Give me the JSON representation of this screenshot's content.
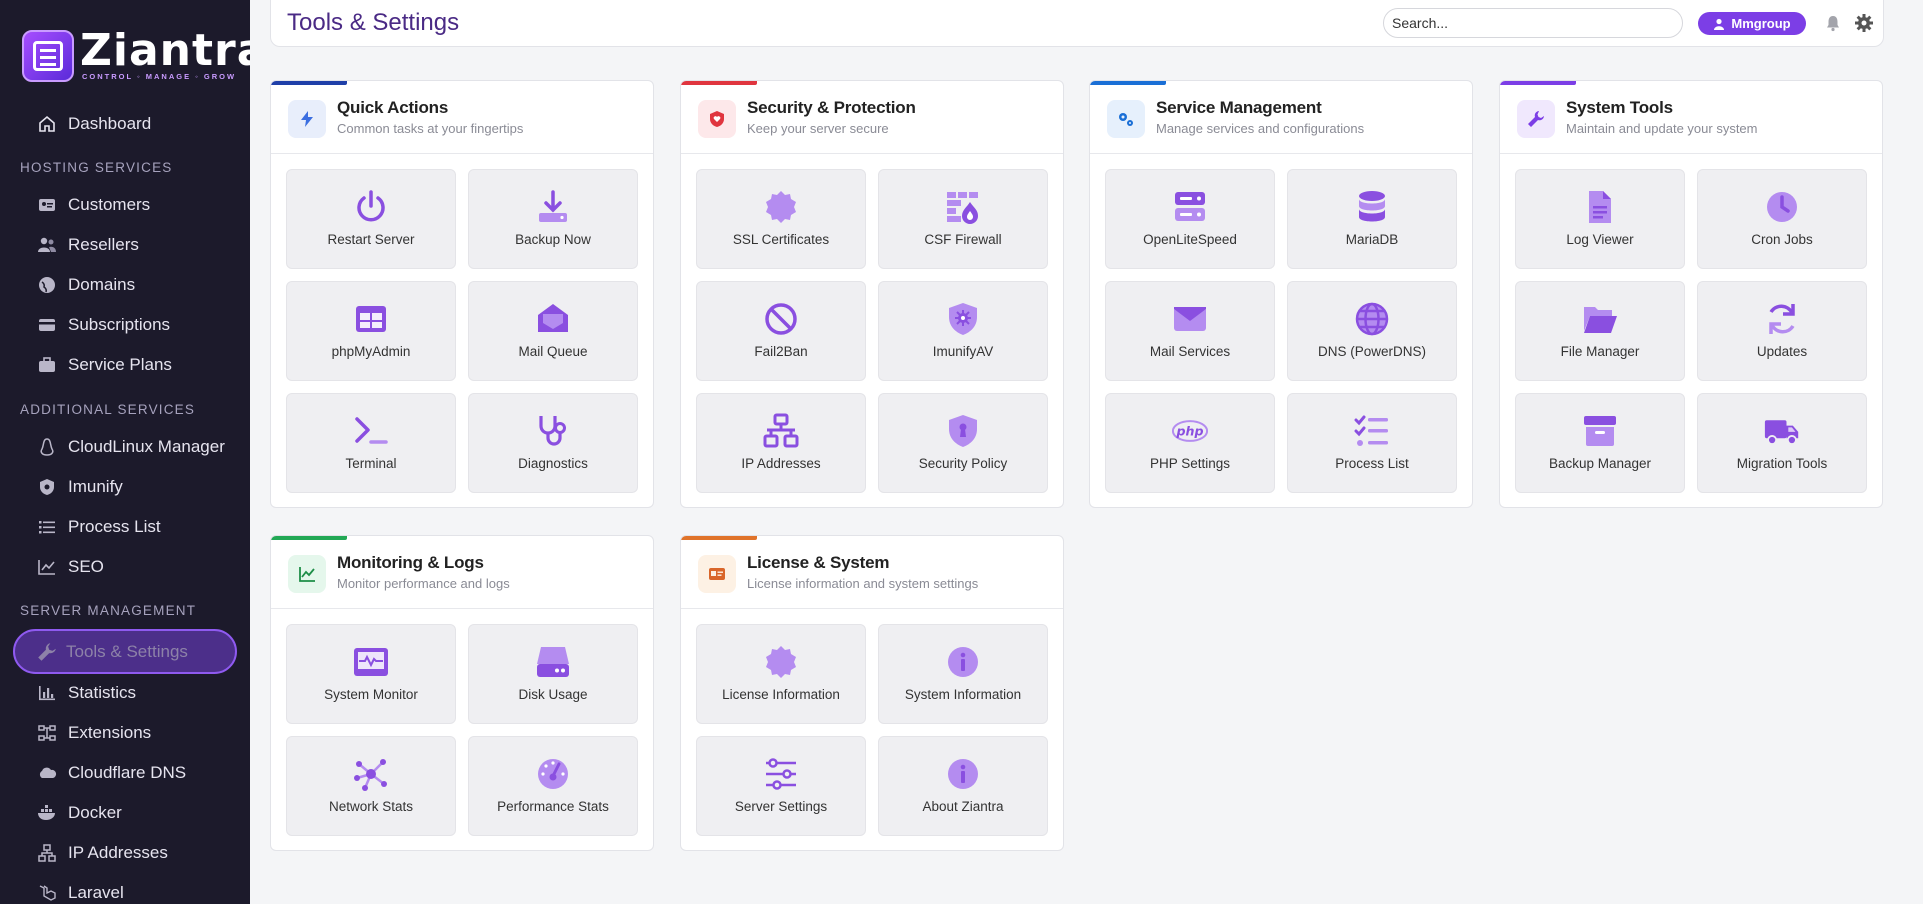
{
  "brand": {
    "name": "Ziantra",
    "tagline": "CONTROL ◦ MANAGE ◦ GROW"
  },
  "sidebar": {
    "top_items": [
      {
        "label": "Dashboard",
        "icon": "home-icon"
      }
    ],
    "sections": [
      {
        "title": "HOSTING SERVICES",
        "items": [
          {
            "label": "Customers",
            "icon": "id-card-icon"
          },
          {
            "label": "Resellers",
            "icon": "users-icon"
          },
          {
            "label": "Domains",
            "icon": "globe-icon"
          },
          {
            "label": "Subscriptions",
            "icon": "credit-card-icon"
          },
          {
            "label": "Service Plans",
            "icon": "briefcase-icon"
          }
        ]
      },
      {
        "title": "ADDITIONAL SERVICES",
        "items": [
          {
            "label": "CloudLinux Manager",
            "icon": "linux-icon"
          },
          {
            "label": "Imunify",
            "icon": "shield-icon"
          },
          {
            "label": "Process List",
            "icon": "list-icon"
          },
          {
            "label": "SEO",
            "icon": "chart-line-icon"
          }
        ]
      },
      {
        "title": "SERVER MANAGEMENT",
        "items": [
          {
            "label": "Tools & Settings",
            "icon": "wrench-icon",
            "active": true
          },
          {
            "label": "Statistics",
            "icon": "bar-chart-icon"
          },
          {
            "label": "Extensions",
            "icon": "extensions-icon"
          },
          {
            "label": "Cloudflare DNS",
            "icon": "cloud-icon"
          },
          {
            "label": "Docker",
            "icon": "docker-icon"
          },
          {
            "label": "IP Addresses",
            "icon": "network-icon"
          },
          {
            "label": "Laravel",
            "icon": "laravel-icon"
          }
        ]
      }
    ]
  },
  "header": {
    "title": "Tools & Settings",
    "search_placeholder": "Search...",
    "user": "Mmgroup"
  },
  "colors": {
    "accent": "#7c3ee6",
    "sidebar_bg": "#1c1a2b",
    "tile_icon": "#8a4fe0"
  },
  "cards": [
    {
      "title": "Quick Actions",
      "subtitle": "Common tasks at your fingertips",
      "accent": "#1f3fa8",
      "icon": "bolt-icon",
      "icon_bg": "#e8eefb",
      "icon_color": "#3b6ee0",
      "tiles": [
        {
          "label": "Restart Server",
          "icon": "power-icon"
        },
        {
          "label": "Backup Now",
          "icon": "download-icon"
        },
        {
          "label": "phpMyAdmin",
          "icon": "table-icon"
        },
        {
          "label": "Mail Queue",
          "icon": "envelope-open-icon"
        },
        {
          "label": "Terminal",
          "icon": "terminal-icon"
        },
        {
          "label": "Diagnostics",
          "icon": "stethoscope-icon"
        }
      ]
    },
    {
      "title": "Security & Protection",
      "subtitle": "Keep your server secure",
      "accent": "#e0353f",
      "icon": "shield-heart-icon",
      "icon_bg": "#fde8ea",
      "icon_color": "#e0353f",
      "tiles": [
        {
          "label": "SSL Certificates",
          "icon": "certificate-icon"
        },
        {
          "label": "CSF Firewall",
          "icon": "firewall-icon"
        },
        {
          "label": "Fail2Ban",
          "icon": "ban-icon"
        },
        {
          "label": "ImunifyAV",
          "icon": "shield-virus-icon"
        },
        {
          "label": "IP Addresses",
          "icon": "network-wired-icon"
        },
        {
          "label": "Security Policy",
          "icon": "shield-keyhole-icon"
        }
      ]
    },
    {
      "title": "Service Management",
      "subtitle": "Manage services and configurations",
      "accent": "#1a6fd6",
      "icon": "cogs-icon",
      "icon_bg": "#e6f0fc",
      "icon_color": "#1a6fd6",
      "tiles": [
        {
          "label": "OpenLiteSpeed",
          "icon": "server-icon"
        },
        {
          "label": "MariaDB",
          "icon": "database-icon"
        },
        {
          "label": "Mail Services",
          "icon": "envelope-icon"
        },
        {
          "label": "DNS (PowerDNS)",
          "icon": "globe-icon"
        },
        {
          "label": "PHP Settings",
          "icon": "php-icon"
        },
        {
          "label": "Process List",
          "icon": "list-check-icon"
        }
      ]
    },
    {
      "title": "System Tools",
      "subtitle": "Maintain and update your system",
      "accent": "#7c3ee6",
      "icon": "wrench-icon",
      "icon_bg": "#f0e8fd",
      "icon_color": "#7c3ee6",
      "tiles": [
        {
          "label": "Log Viewer",
          "icon": "file-lines-icon"
        },
        {
          "label": "Cron Jobs",
          "icon": "clock-icon"
        },
        {
          "label": "File Manager",
          "icon": "folder-open-icon"
        },
        {
          "label": "Updates",
          "icon": "sync-icon"
        },
        {
          "label": "Backup Manager",
          "icon": "archive-icon"
        },
        {
          "label": "Migration Tools",
          "icon": "truck-icon"
        }
      ]
    },
    {
      "title": "Monitoring & Logs",
      "subtitle": "Monitor performance and logs",
      "accent": "#22a855",
      "icon": "chart-line-icon",
      "icon_bg": "#e5f7ec",
      "icon_color": "#1e8e48",
      "tiles": [
        {
          "label": "System Monitor",
          "icon": "monitor-pulse-icon"
        },
        {
          "label": "Disk Usage",
          "icon": "hdd-icon"
        },
        {
          "label": "Network Stats",
          "icon": "network-nodes-icon"
        },
        {
          "label": "Performance Stats",
          "icon": "gauge-icon"
        }
      ]
    },
    {
      "title": "License & System",
      "subtitle": "License information and system settings",
      "accent": "#e0732a",
      "icon": "id-badge-icon",
      "icon_bg": "#fdf1e4",
      "icon_color": "#d9662a",
      "tiles": [
        {
          "label": "License Information",
          "icon": "certificate-icon"
        },
        {
          "label": "System Information",
          "icon": "info-circle-icon"
        },
        {
          "label": "Server Settings",
          "icon": "sliders-icon"
        },
        {
          "label": "About Ziantra",
          "icon": "info-circle-icon"
        }
      ]
    }
  ]
}
